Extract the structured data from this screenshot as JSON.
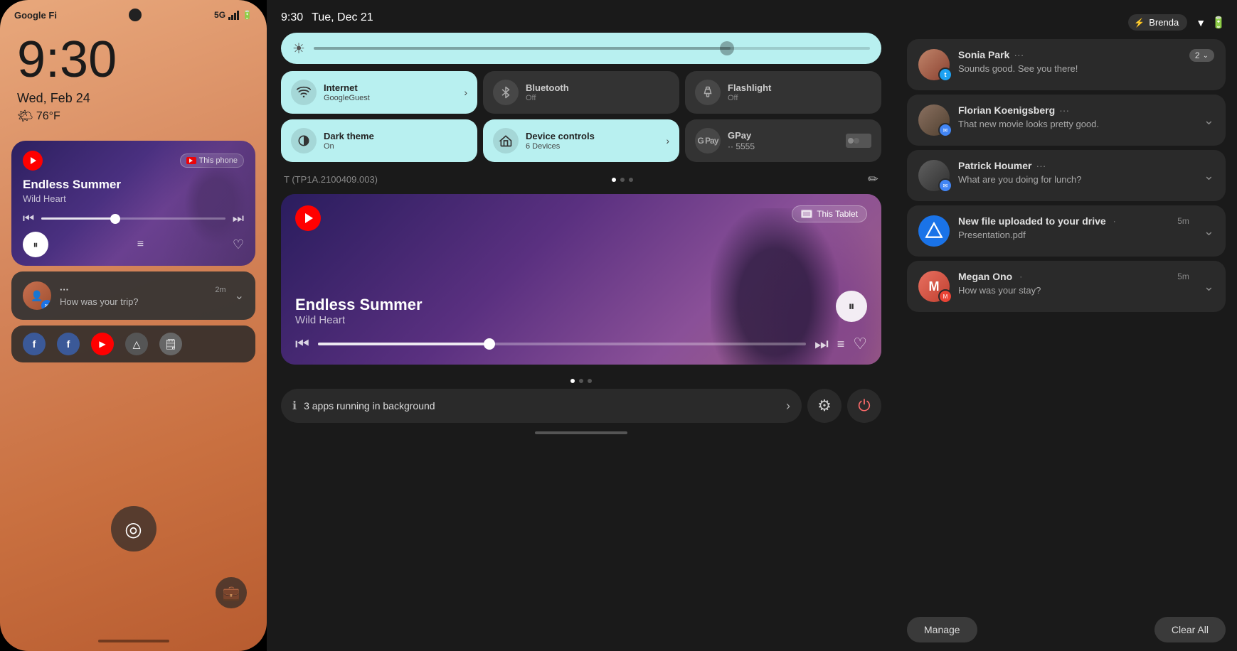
{
  "phone": {
    "carrier": "Google Fi",
    "network": "5G",
    "time": "9:30",
    "date": "Wed, Feb 24",
    "weather": "76°F",
    "weather_icon": "🌤",
    "music": {
      "source_label": "This phone",
      "title": "Endless Summer",
      "subtitle": "Wild Heart",
      "progress": "40"
    },
    "notification": {
      "sender": "...",
      "time": "2m",
      "message": "How was your trip?"
    },
    "apps": [
      "🔵",
      "🔵",
      "▶",
      "△",
      "🗒"
    ]
  },
  "tablet": {
    "time": "9:30",
    "date": "Tue, Dec 21",
    "brightness": 75,
    "tiles": [
      {
        "id": "internet",
        "label": "Internet",
        "sublabel": "GoogleGuest",
        "active": true,
        "icon": "wifi"
      },
      {
        "id": "bluetooth",
        "label": "Bluetooth",
        "sublabel": "Off",
        "active": false,
        "icon": "bluetooth"
      },
      {
        "id": "flashlight",
        "label": "Flashlight",
        "sublabel": "Off",
        "active": false,
        "icon": "flashlight"
      },
      {
        "id": "darktheme",
        "label": "Dark theme",
        "sublabel": "On",
        "active": true,
        "icon": "darktheme"
      },
      {
        "id": "devicecontrols",
        "label": "Device controls",
        "sublabel": "6 Devices",
        "active": true,
        "icon": "home",
        "chevron": true
      },
      {
        "id": "gpay",
        "label": "GPay",
        "sublabel": "·· 5555",
        "active": false,
        "icon": "gpay"
      }
    ],
    "device_id": "T (TP1A.2100409.003)",
    "music": {
      "title": "Endless Summer",
      "subtitle": "Wild Heart",
      "source_label": "This Tablet"
    },
    "apps_running": "3 apps running in background"
  },
  "notifications": {
    "user": "Brenda",
    "items": [
      {
        "id": "sonia",
        "name": "Sonia Park",
        "dots": "···",
        "message": "Sounds good. See you there!",
        "count": "2",
        "has_badge": true,
        "badge_type": "twitter"
      },
      {
        "id": "florian",
        "name": "Florian Koenigsberg",
        "dots": "···",
        "message": "That new movie looks pretty good.",
        "has_badge": true,
        "badge_type": "messages"
      },
      {
        "id": "patrick",
        "name": "Patrick Houmer",
        "dots": "···",
        "message": "What are you doing for lunch?",
        "has_badge": true,
        "badge_type": "messages"
      },
      {
        "id": "drive",
        "name": "New file uploaded to your drive",
        "time": "5m",
        "message": "Presentation.pdf",
        "has_badge": false
      },
      {
        "id": "megan",
        "name": "Megan Ono",
        "time": "5m",
        "message": "How was your stay?",
        "has_badge": true,
        "badge_type": "megan"
      }
    ],
    "manage_label": "Manage",
    "clear_all_label": "Clear All"
  },
  "icons": {
    "pause": "⏸",
    "prev": "⏮",
    "next": "⏭",
    "heart": "♡",
    "queue": "≡+",
    "wifi": "📶",
    "bt": "⚡",
    "flash": "🔦",
    "moon": "◑",
    "home": "⌂",
    "gear": "⚙",
    "power": "⏻",
    "fingerprint": "◎",
    "briefcase": "💼",
    "sun": "☀",
    "info": "ℹ",
    "chevron_right": "›",
    "chevron_down": "⌄",
    "edit": "✏",
    "twitter": "t",
    "msg": "✉",
    "drive": "△"
  }
}
